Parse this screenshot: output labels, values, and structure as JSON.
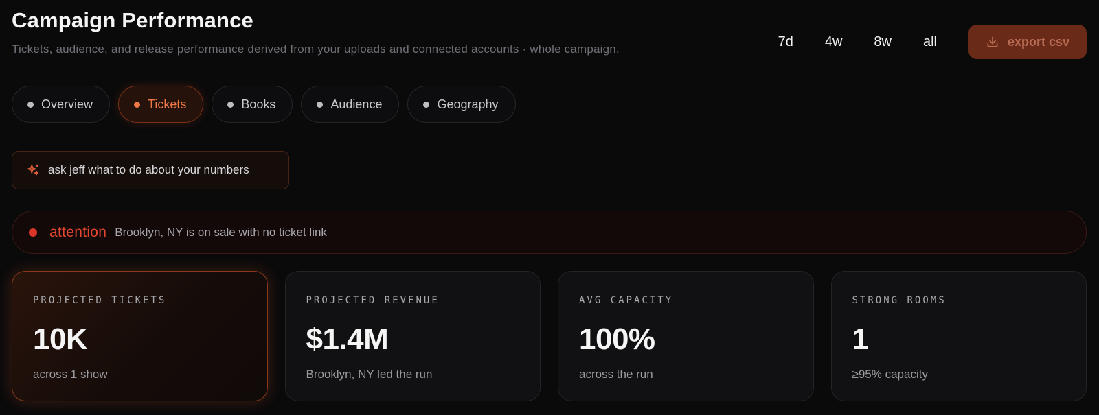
{
  "header": {
    "title": "Campaign Performance",
    "subtitle": "Tickets, audience, and release performance derived from your uploads and connected accounts · whole campaign."
  },
  "range": {
    "options": [
      "7d",
      "4w",
      "8w",
      "all"
    ]
  },
  "export": {
    "label": "export csv",
    "icon": "download-icon"
  },
  "tabs": [
    {
      "label": "Overview",
      "active": false
    },
    {
      "label": "Tickets",
      "active": true
    },
    {
      "label": "Books",
      "active": false
    },
    {
      "label": "Audience",
      "active": false
    },
    {
      "label": "Geography",
      "active": false
    }
  ],
  "ask": {
    "label": "ask jeff what to do about your numbers",
    "icon": "sparkle-icon"
  },
  "alert": {
    "label": "attention",
    "message": "Brooklyn, NY is on sale with no ticket link"
  },
  "cards": [
    {
      "label": "PROJECTED TICKETS",
      "value": "10K",
      "note": "across 1 show"
    },
    {
      "label": "PROJECTED REVENUE",
      "value": "$1.4M",
      "note": "Brooklyn, NY led the run"
    },
    {
      "label": "AVG CAPACITY",
      "value": "100%",
      "note": "across the run"
    },
    {
      "label": "STRONG ROOMS",
      "value": "1",
      "note": "≥95% capacity"
    }
  ],
  "colors": {
    "accent": "#f07a45",
    "alert": "#d9362a",
    "background": "#0a0a0b"
  }
}
